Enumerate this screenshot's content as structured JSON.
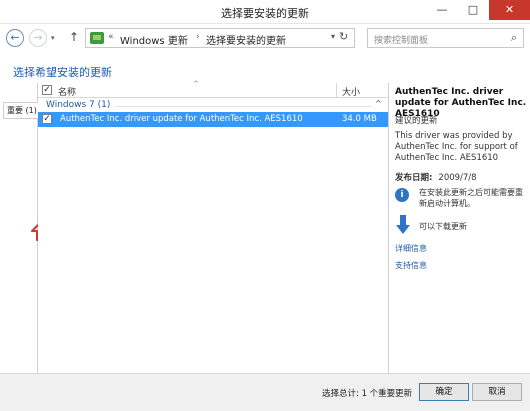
{
  "window": {
    "title": "选择要安装的更新",
    "minimize_glyph": "—",
    "maximize_glyph": "□",
    "close_glyph": "✕"
  },
  "nav": {
    "back_glyph": "←",
    "forward_glyph": "→",
    "recent_glyph": "▾",
    "up_glyph": "↑",
    "breadcrumb_sep": "«",
    "breadcrumb": [
      "Windows 更新",
      "选择要安装的更新"
    ],
    "crumb_sep": "›",
    "dropdown_glyph": "▾",
    "refresh_glyph": "↻",
    "search_placeholder": "搜索控制面板",
    "search_glyph": "⌕"
  },
  "header": {
    "title": "选择希望安装的更新"
  },
  "categories": [
    {
      "label": "重要 (1)",
      "selected": true
    }
  ],
  "list": {
    "columns": {
      "name": "名称",
      "size": "大小",
      "sort_glyph": "^"
    },
    "group": {
      "label": "Windows 7 (1)",
      "collapse_glyph": "^"
    },
    "rows": [
      {
        "name": "AuthenTec Inc. driver update for AuthenTec Inc. AES1610",
        "size": "34.0 MB",
        "checked": true,
        "selected": true
      }
    ],
    "check_glyph": "✓"
  },
  "details": {
    "title": "AuthenTec Inc. driver update for AuthenTec Inc. AES1610",
    "recommendation": "建议的更新",
    "description": "This driver was provided by AuthenTec Inc. for support of AuthenTec Inc. AES1610",
    "date_key": "发布日期:",
    "date_value": "2009/7/8",
    "restart_text": "在安装此更新之后可能需要重新启动计算机。",
    "restart_glyph": "i",
    "download_text": "可以下载更新",
    "link_details": "详细信息",
    "link_support": "支持信息"
  },
  "footer": {
    "status": "选择总计: 1 个重要更新",
    "ok_label": "确定",
    "cancel_label": "取消"
  },
  "colors": {
    "accent": "#1e5aa8",
    "selection": "#3399ff",
    "close_button": "#c7372b",
    "indicator_arrow": "#d9362b"
  }
}
